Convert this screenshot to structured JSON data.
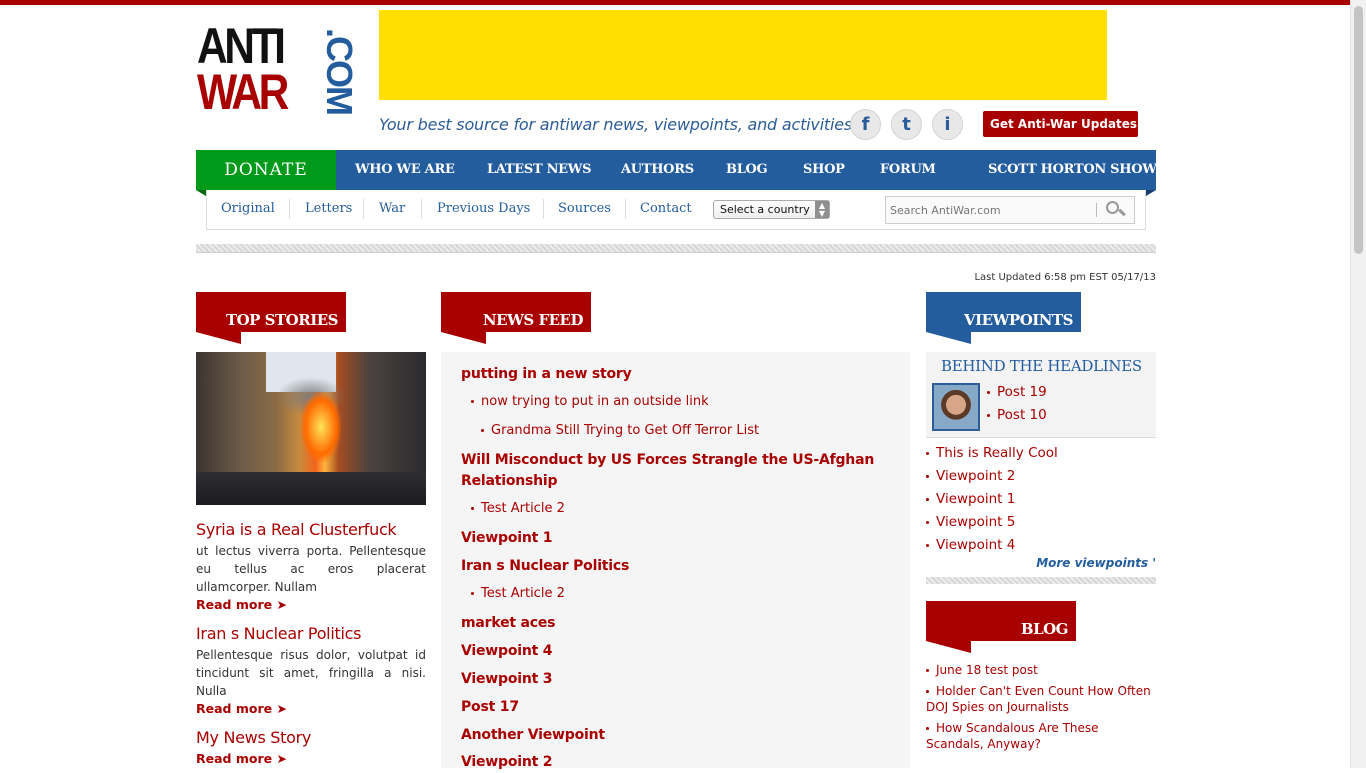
{
  "site": {
    "logo_line1": "ANTI",
    "logo_line2": "WAR",
    "logo_com": ".COM",
    "tagline": "Your best source for antiwar news, viewpoints, and activities.",
    "updates_button": "Get Anti-War Updates ▾",
    "last_updated": "Last Updated 6:58 pm EST 05/17/13"
  },
  "social": [
    {
      "icon": "facebook-icon",
      "glyph": "f"
    },
    {
      "icon": "twitter-icon",
      "glyph": "t"
    },
    {
      "icon": "rss-icon",
      "glyph": "i"
    }
  ],
  "nav": {
    "donate": "DONATE",
    "items": [
      "WHO WE ARE",
      "LATEST NEWS",
      "AUTHORS",
      "BLOG",
      "SHOP",
      "FORUM",
      "SCOTT HORTON SHOW"
    ]
  },
  "subnav": {
    "items": [
      "Original",
      "Letters",
      "War",
      "Previous Days",
      "Sources",
      "Contact"
    ],
    "country_select": "Select a country",
    "search_placeholder": "Search AntiWar.com"
  },
  "top_stories": {
    "heading": "TOP STORIES",
    "stories": [
      {
        "title": "Syria is a Real Clusterfuck",
        "text": "ut lectus viverra porta. Pellentesque eu tellus ac eros placerat ullamcorper. Nullam",
        "more": "Read more ➤"
      },
      {
        "title": "Iran s Nuclear Politics",
        "text": "Pellentesque risus dolor, volutpat id tincidunt sit amet, fringilla a nisi. Nulla",
        "more": "Read more ➤"
      },
      {
        "title": "My News Story",
        "text": "",
        "more": "Read more ➤"
      }
    ]
  },
  "news_feed": {
    "heading": "NEWS FEED",
    "h1": "putting in a new story",
    "s1": "now trying to put in an outside link",
    "s2": "Grandma Still Trying to Get Off Terror List",
    "h2": "Will Misconduct by US Forces Strangle the US-Afghan Relationship",
    "s3": "Test Article 2",
    "h3": "Viewpoint 1",
    "h4": "Iran s Nuclear Politics",
    "s4": "Test Article 2",
    "h5": "market aces",
    "h6": "Viewpoint 4",
    "h7": "Viewpoint 3",
    "h8": "Post 17",
    "h9": "Another Viewpoint",
    "h10": "Viewpoint 2"
  },
  "viewpoints": {
    "heading": "VIEWPOINTS",
    "bth_title": "BEHIND THE HEADLINES",
    "posts": [
      "Post 19",
      "Post 10"
    ],
    "links": [
      "This is Really Cool",
      "Viewpoint 2",
      "Viewpoint 1",
      "Viewpoint 5",
      "Viewpoint 4"
    ],
    "more": "More viewpoints '"
  },
  "blog": {
    "heading": "BLOG",
    "links": [
      "June 18 test post",
      "Holder Can't Even Count How Often DOJ Spies on Journalists",
      "How Scandalous Are These Scandals, Anyway?"
    ]
  },
  "colors": {
    "brand_red": "#a80000",
    "brand_blue": "#245d9e",
    "donate_green": "#009a1a",
    "ad_yellow": "#ffde00"
  }
}
